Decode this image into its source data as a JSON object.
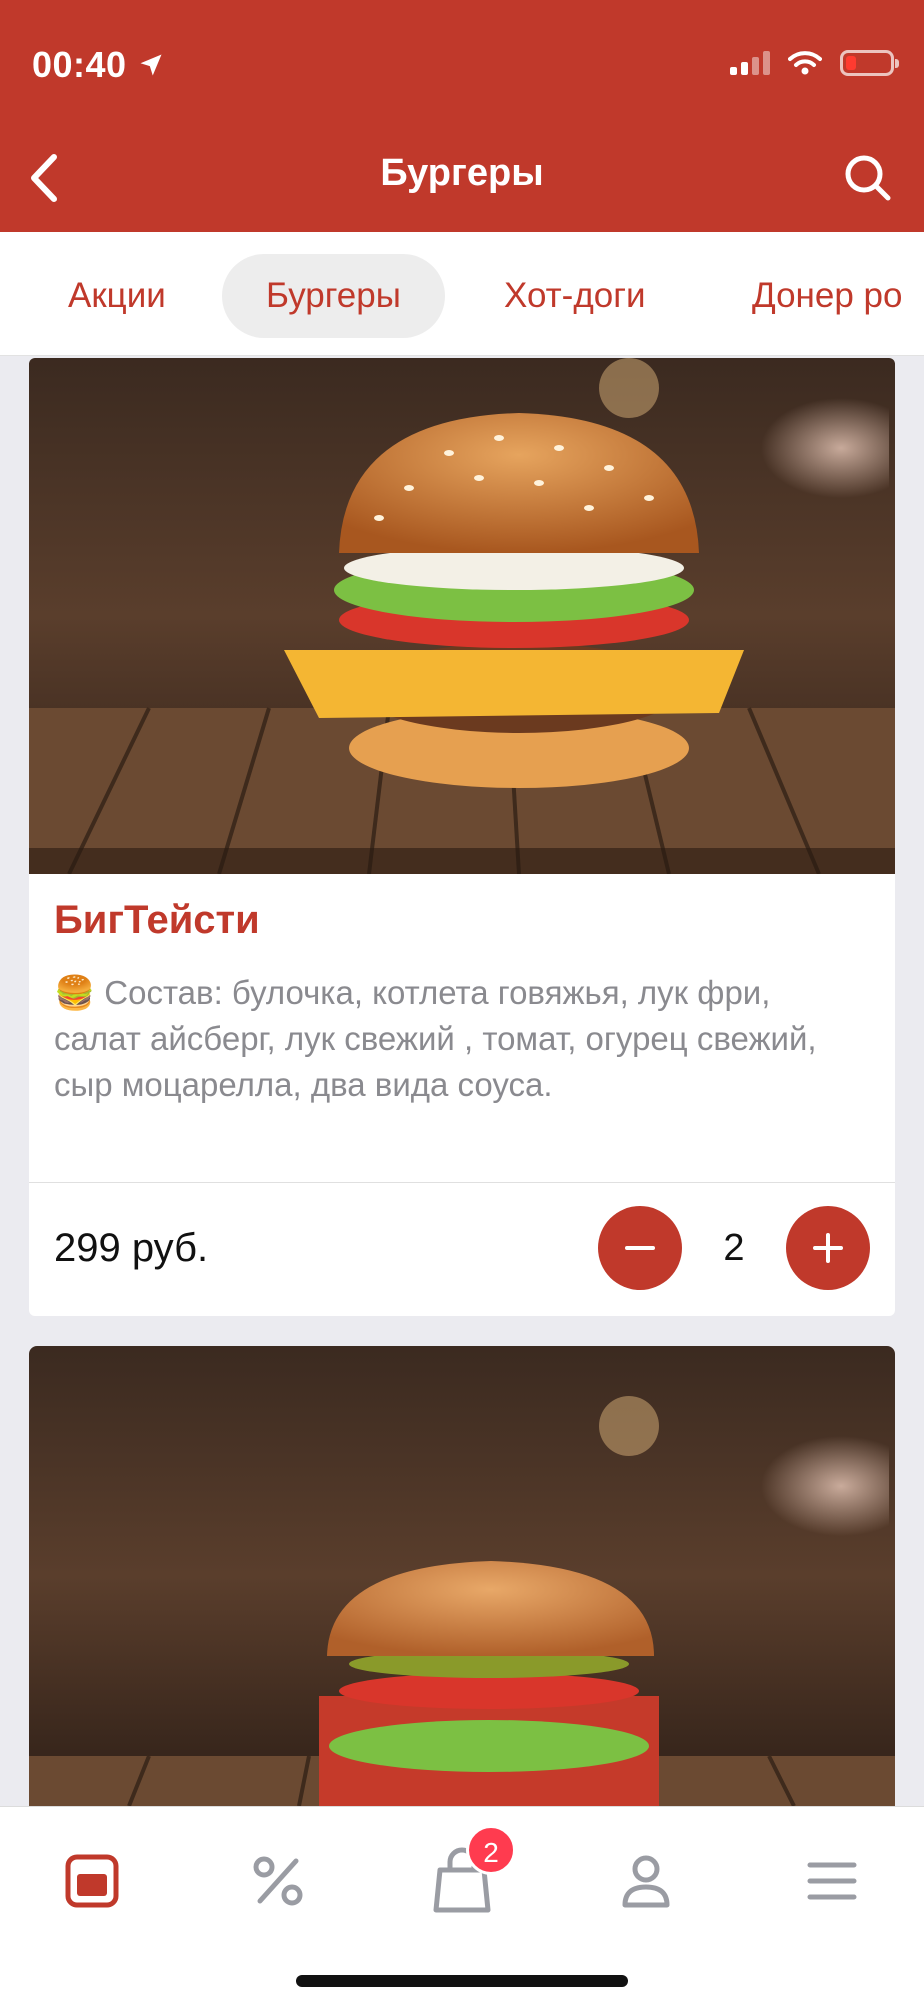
{
  "status": {
    "time": "00:40"
  },
  "header": {
    "title": "Бургеры"
  },
  "tabs": [
    {
      "label": "Акции"
    },
    {
      "label": "Бургеры",
      "active": true
    },
    {
      "label": "Хот-доги"
    },
    {
      "label": "Донер ро"
    }
  ],
  "products": [
    {
      "title": "БигТейсти",
      "description": "🍔 Состав: булочка, котлета говяжья, лук фри, салат айсберг, лук свежий , томат, огурец свежий, сыр моцарелла, два вида соуса.",
      "price": "299 руб.",
      "quantity": "2"
    }
  ],
  "bottom_nav": {
    "items": [
      "menu-icon",
      "discount-icon",
      "cart-icon",
      "profile-icon",
      "more-icon"
    ],
    "cart_badge": "2"
  },
  "colors": {
    "brand": "#c0392b",
    "badge": "#ff3b4f",
    "background": "#ebebf0"
  }
}
